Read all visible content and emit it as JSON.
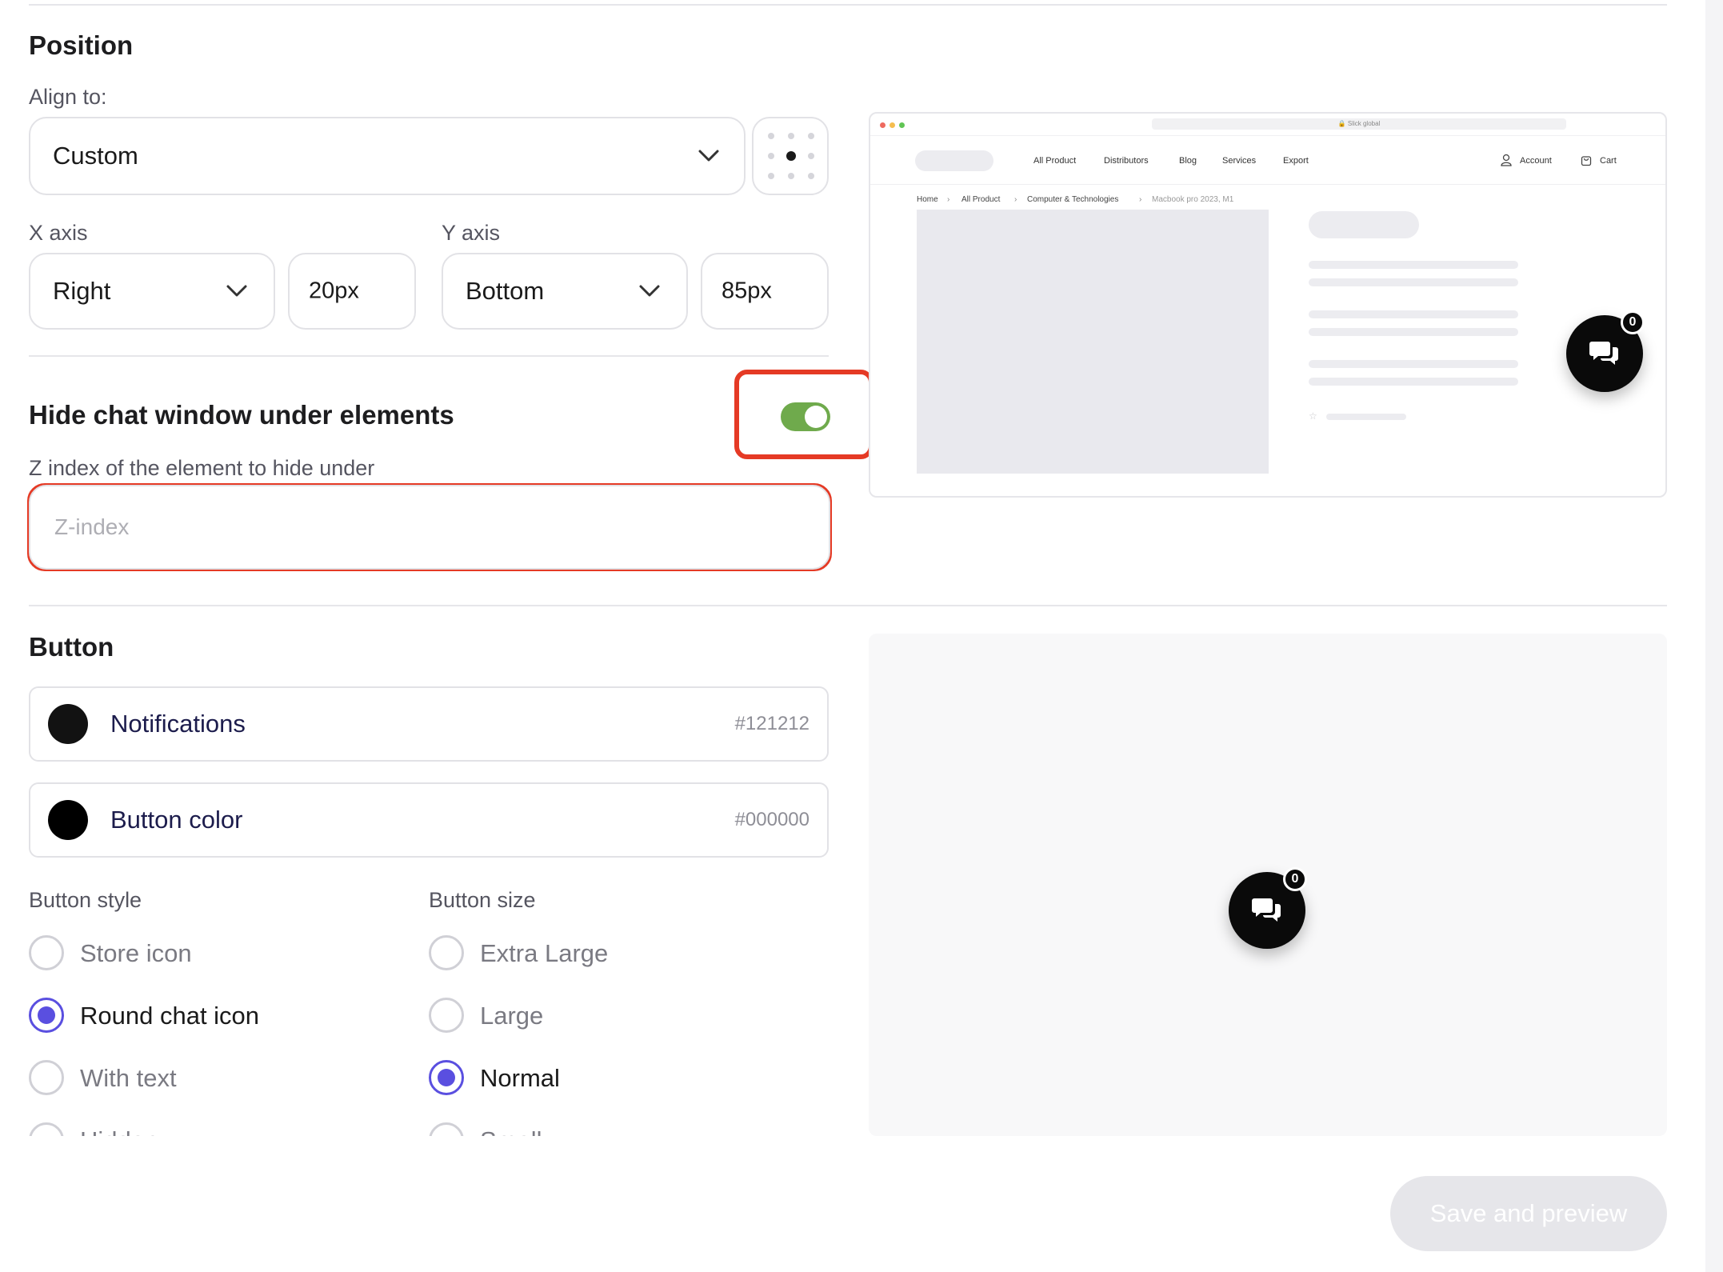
{
  "position": {
    "title": "Position",
    "align_label": "Align to:",
    "align_value": "Custom",
    "x_axis_label": "X axis",
    "x_axis_value": "Right",
    "x_offset": "20px",
    "y_axis_label": "Y axis",
    "y_axis_value": "Bottom",
    "y_offset": "85px"
  },
  "hide": {
    "title": "Hide chat window under elements",
    "toggle_on": true,
    "zindex_label": "Z index of the element to hide under",
    "zindex_value": "",
    "zindex_placeholder": "Z-index",
    "highlight_color": "#e53a25",
    "toggle_color": "#6faa4c"
  },
  "button": {
    "title": "Button",
    "colors": [
      {
        "name": "Notifications",
        "hex": "#121212",
        "swatch": "#121212"
      },
      {
        "name": "Button color",
        "hex": "#000000",
        "swatch": "#000000"
      }
    ],
    "style_label": "Button style",
    "style_options": [
      {
        "label": "Store icon",
        "checked": false
      },
      {
        "label": "Round chat icon",
        "checked": true
      },
      {
        "label": "With text",
        "checked": false
      },
      {
        "label": "Hidden",
        "checked": false
      }
    ],
    "size_label": "Button size",
    "size_options": [
      {
        "label": "Extra Large",
        "checked": false
      },
      {
        "label": "Large",
        "checked": false
      },
      {
        "label": "Normal",
        "checked": true
      },
      {
        "label": "Small",
        "checked": false
      }
    ],
    "accent_color": "#5a4fe0"
  },
  "preview": {
    "url": "🔒 Slick global",
    "nav_items": [
      "All Product",
      "Distributors",
      "Blog",
      "Services",
      "Export"
    ],
    "account": "Account",
    "cart": "Cart",
    "breadcrumb": [
      "Home",
      "All Product",
      "Computer & Technologies",
      "Macbook pro 2023, M1"
    ],
    "badge_count": "0"
  },
  "footer": {
    "save_label": "Save and preview"
  },
  "icons": {
    "chevron": "chevron-down-icon",
    "grid": "alignment-grid-icon",
    "chat": "chat-bubbles-icon",
    "account": "user-icon",
    "cart": "bag-icon"
  }
}
